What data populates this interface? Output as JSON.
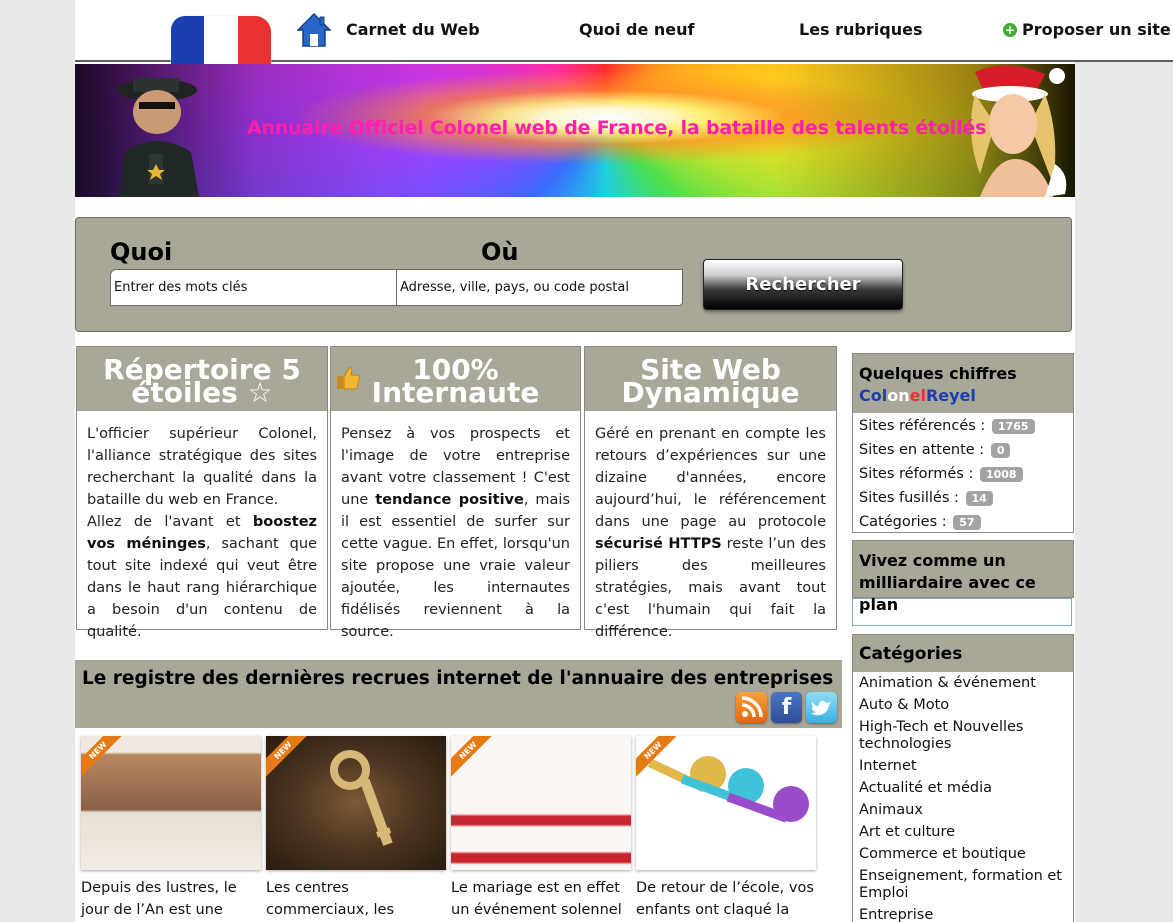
{
  "header": {
    "nav": [
      "Carnet du Web",
      "Quoi de neuf",
      "Les rubriques",
      "Proposer un site"
    ]
  },
  "banner": {
    "title": "Annuaire Officiel Colonel web de France, la bataille des talents étoilés"
  },
  "search": {
    "what_label": "Quoi",
    "where_label": "Où",
    "what_placeholder": "Entrer des mots clés",
    "where_placeholder": "Adresse, ville, pays, ou code postal",
    "button_label": "Rechercher"
  },
  "features": [
    {
      "title_line1": "Répertoire 5",
      "title_line2": "étoiles ☆",
      "paragraphs": [
        [
          "L'officier supérieur Colonel, l'alliance stratégique des sites recherchant la qualité dans la bataille du web en France."
        ],
        [
          "Allez de l'avant et ",
          "boostez vos méninges",
          ", sachant que tout site indexé qui veut être dans le haut rang hiérarchique a besoin d'un contenu de qualité."
        ]
      ]
    },
    {
      "title_line1": "100%",
      "title_line2": "Internaute",
      "paragraphs": [
        [
          "Pensez à vos prospects et l'image de votre entreprise avant votre classement ! C'est une ",
          "tendance positive",
          ", mais il est essentiel de surfer sur cette vague. En effet, lorsqu'un site propose une vraie valeur ajoutée, les internautes fidélisés reviennent à la source."
        ]
      ]
    },
    {
      "title_line1": "Site Web",
      "title_line2": "Dynamique",
      "paragraphs": [
        [
          "Géré en prenant en compte les retours d’expériences sur une dizaine d'années, encore aujourd’hui, le référencement dans une page au protocole ",
          "sécurisé HTTPS",
          " reste l’un des piliers des meilleures stratégies, mais avant tout c'est l'humain qui fait la différence."
        ]
      ]
    }
  ],
  "stats": {
    "heading": "Quelques chiffres",
    "brand": [
      "Col",
      "on",
      "el",
      "Reyel"
    ],
    "brand_colors": [
      "#1b3fb0",
      "#ffffff",
      "#e8322f",
      "#1b3fb0"
    ],
    "rows": [
      {
        "label": "Sites référencés :",
        "value": "1765"
      },
      {
        "label": "Sites en attente :",
        "value": "0"
      },
      {
        "label": "Sites réformés :",
        "value": "1008"
      },
      {
        "label": "Sites fusillés :",
        "value": "14"
      },
      {
        "label": "Catégories :",
        "value": "57"
      }
    ]
  },
  "plan": {
    "heading": "Vivez comme un milliardaire avec ce plan"
  },
  "categories": {
    "heading": "Catégories",
    "items": [
      "Animation & événement",
      "Auto & Moto",
      "High-Tech et Nouvelles technologies",
      "Internet",
      "Actualité et média",
      "Animaux",
      "Art et culture",
      "Commerce et boutique",
      "Enseignement, formation et Emploi",
      "Entreprise"
    ]
  },
  "register": {
    "title": "Le registre des dernières recrues internet de l'annuaire des entreprises",
    "social": [
      "rss-icon",
      "facebook-icon",
      "twitter-icon"
    ],
    "ribbon": "NEW",
    "cards": [
      {
        "text": "Depuis des lustres, le jour de l’An est une"
      },
      {
        "text": "Les centres commerciaux, les"
      },
      {
        "text": "Le mariage est en effet un événement solennel"
      },
      {
        "text": "De retour de l’école, vos enfants ont claqué la"
      }
    ]
  },
  "colors": {
    "panel": "#a9a797",
    "banner_title": "#ff1fae",
    "badge": "#a3a3a3",
    "ribbon": "#e57a12"
  }
}
